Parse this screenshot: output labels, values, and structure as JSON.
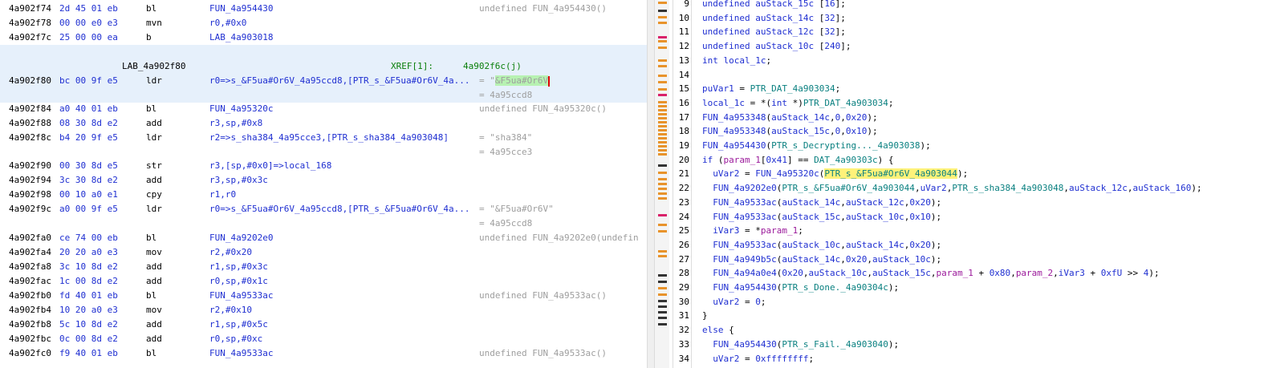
{
  "listing": {
    "rows": [
      {
        "addr": "4a902f74",
        "bytes": "2d 45 01 eb",
        "mnem": "bl",
        "operand": "FUN_4a954430",
        "comment": "undefined FUN_4a954430()"
      },
      {
        "addr": "4a902f78",
        "bytes": "00 00 e0 e3",
        "mnem": "mvn",
        "operand": "r0,#0x0",
        "comment": ""
      },
      {
        "addr": "4a902f7c",
        "bytes": "25 00 00 ea",
        "mnem": "b",
        "operand": "LAB_4a903018",
        "comment": ""
      },
      {
        "addr": "4a902f80",
        "bytes": "bc 00 9f e5",
        "mnem": "ldr",
        "operand": "r0=>s_&F5ua#Or6V_4a95ccd8,[PTR_s_&F5ua#Or6V_4a...",
        "comment": "= \"&F5ua#Or6V\"",
        "comment2": "= 4a95ccd8"
      },
      {
        "addr": "4a902f84",
        "bytes": "a0 40 01 eb",
        "mnem": "bl",
        "operand": "FUN_4a95320c",
        "comment": "undefined FUN_4a95320c()"
      },
      {
        "addr": "4a902f88",
        "bytes": "08 30 8d e2",
        "mnem": "add",
        "operand": "r3,sp,#0x8",
        "comment": ""
      },
      {
        "addr": "4a902f8c",
        "bytes": "b4 20 9f e5",
        "mnem": "ldr",
        "operand": "r2=>s_sha384_4a95cce3,[PTR_s_sha384_4a903048]",
        "comment": "= \"sha384\"",
        "comment2": "= 4a95cce3"
      },
      {
        "addr": "4a902f90",
        "bytes": "00 30 8d e5",
        "mnem": "str",
        "operand": "r3,[sp,#0x0]=>local_168",
        "comment": ""
      },
      {
        "addr": "4a902f94",
        "bytes": "3c 30 8d e2",
        "mnem": "add",
        "operand": "r3,sp,#0x3c",
        "comment": ""
      },
      {
        "addr": "4a902f98",
        "bytes": "00 10 a0 e1",
        "mnem": "cpy",
        "operand": "r1,r0",
        "comment": ""
      },
      {
        "addr": "4a902f9c",
        "bytes": "a0 00 9f e5",
        "mnem": "ldr",
        "operand": "r0=>s_&F5ua#Or6V_4a95ccd8,[PTR_s_&F5ua#Or6V_4a...",
        "comment": "= \"&F5ua#Or6V\"",
        "comment2": "= 4a95ccd8"
      },
      {
        "addr": "4a902fa0",
        "bytes": "ce 74 00 eb",
        "mnem": "bl",
        "operand": "FUN_4a9202e0",
        "comment": "undefined FUN_4a9202e0(undefin"
      },
      {
        "addr": "4a902fa4",
        "bytes": "20 20 a0 e3",
        "mnem": "mov",
        "operand": "r2,#0x20",
        "comment": ""
      },
      {
        "addr": "4a902fa8",
        "bytes": "3c 10 8d e2",
        "mnem": "add",
        "operand": "r1,sp,#0x3c",
        "comment": ""
      },
      {
        "addr": "4a902fac",
        "bytes": "1c 00 8d e2",
        "mnem": "add",
        "operand": "r0,sp,#0x1c",
        "comment": ""
      },
      {
        "addr": "4a902fb0",
        "bytes": "fd 40 01 eb",
        "mnem": "bl",
        "operand": "FUN_4a9533ac",
        "comment": "undefined FUN_4a9533ac()"
      },
      {
        "addr": "4a902fb4",
        "bytes": "10 20 a0 e3",
        "mnem": "mov",
        "operand": "r2,#0x10",
        "comment": ""
      },
      {
        "addr": "4a902fb8",
        "bytes": "5c 10 8d e2",
        "mnem": "add",
        "operand": "r1,sp,#0x5c",
        "comment": ""
      },
      {
        "addr": "4a902fbc",
        "bytes": "0c 00 8d e2",
        "mnem": "add",
        "operand": "r0,sp,#0xc",
        "comment": ""
      },
      {
        "addr": "4a902fc0",
        "bytes": "f9 40 01 eb",
        "mnem": "bl",
        "operand": "FUN_4a9533ac",
        "comment": "undefined FUN_4a9533ac()"
      }
    ],
    "label": "LAB_4a902f80",
    "xref_label": "XREF[1]:",
    "xref_addr": "4a902f6c(j)",
    "highlight_text": "&F5ua#Or6V"
  },
  "decompiler": {
    "lines": [
      {
        "n": "9",
        "code": "undefined auStack_15c [16];"
      },
      {
        "n": "10",
        "code": "undefined auStack_14c [32];"
      },
      {
        "n": "11",
        "code": "undefined auStack_12c [32];"
      },
      {
        "n": "12",
        "code": "undefined auStack_10c [240];"
      },
      {
        "n": "13",
        "code": "int local_1c;"
      },
      {
        "n": "14",
        "code": ""
      },
      {
        "n": "15",
        "code": "puVar1 = PTR_DAT_4a903034;"
      },
      {
        "n": "16",
        "code": "local_1c = *(int *)PTR_DAT_4a903034;"
      },
      {
        "n": "17",
        "code": "FUN_4a953348(auStack_14c,0,0x20);"
      },
      {
        "n": "18",
        "code": "FUN_4a953348(auStack_15c,0,0x10);"
      },
      {
        "n": "19",
        "code": "FUN_4a954430(PTR_s_Decrypting..._4a903038);"
      },
      {
        "n": "20",
        "code": "if (param_1[0x41] == DAT_4a90303c) {"
      },
      {
        "n": "21",
        "code": "  uVar2 = FUN_4a95320c(PTR_s_&F5ua#Or6V_4a903044);"
      },
      {
        "n": "22",
        "code": "  FUN_4a9202e0(PTR_s_&F5ua#Or6V_4a903044,uVar2,PTR_s_sha384_4a903048,auStack_12c,auStack_160);"
      },
      {
        "n": "23",
        "code": "  FUN_4a9533ac(auStack_14c,auStack_12c,0x20);"
      },
      {
        "n": "24",
        "code": "  FUN_4a9533ac(auStack_15c,auStack_10c,0x10);"
      },
      {
        "n": "25",
        "code": "  iVar3 = *param_1;"
      },
      {
        "n": "26",
        "code": "  FUN_4a9533ac(auStack_10c,auStack_14c,0x20);"
      },
      {
        "n": "27",
        "code": "  FUN_4a949b5c(auStack_14c,0x20,auStack_10c);"
      },
      {
        "n": "28",
        "code": "  FUN_4a94a0e4(0x20,auStack_10c,auStack_15c,param_1 + 0x80,param_2,iVar3 + 0xfU >> 4);"
      },
      {
        "n": "29",
        "code": "  FUN_4a954430(PTR_s_Done._4a90304c);"
      },
      {
        "n": "30",
        "code": "  uVar2 = 0;"
      },
      {
        "n": "31",
        "code": "}"
      },
      {
        "n": "32",
        "code": "else {"
      },
      {
        "n": "33",
        "code": "  FUN_4a954430(PTR_s_Fail._4a903040);"
      },
      {
        "n": "34",
        "code": "  uVar2 = 0xffffffff;"
      }
    ],
    "highlight_text": "PTR_s_&F5ua#Or6V_4a903044"
  }
}
